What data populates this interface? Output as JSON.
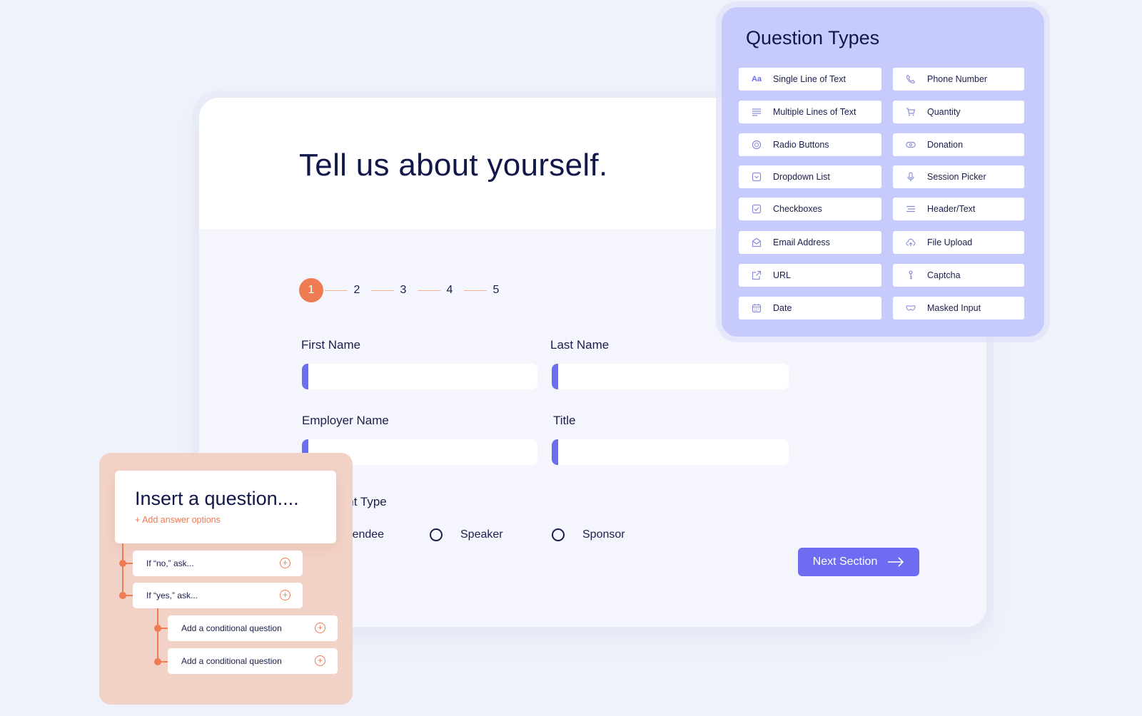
{
  "form": {
    "title": "Tell us about yourself.",
    "steps": [
      "1",
      "2",
      "3",
      "4",
      "5"
    ],
    "active_step": 1,
    "fields": {
      "first_name_label": "First Name",
      "last_name_label": "Last Name",
      "employer_name_label": "Employer Name",
      "title_label": "Title",
      "registrant_type_label": "Registrant Type"
    },
    "radio_options": [
      "Attendee",
      "Speaker",
      "Sponsor"
    ],
    "next_button_label": "Next Section"
  },
  "question_types": {
    "title": "Question Types",
    "items": [
      {
        "label": "Single Line of Text",
        "icon": "text-aa-icon"
      },
      {
        "label": "Phone Number",
        "icon": "phone-icon"
      },
      {
        "label": "Multiple Lines of Text",
        "icon": "multiline-text-icon"
      },
      {
        "label": "Quantity",
        "icon": "cart-icon"
      },
      {
        "label": "Radio Buttons",
        "icon": "radio-button-icon"
      },
      {
        "label": "Donation",
        "icon": "ticket-icon"
      },
      {
        "label": "Dropdown List",
        "icon": "dropdown-icon"
      },
      {
        "label": "Session Picker",
        "icon": "microphone-icon"
      },
      {
        "label": "Checkboxes",
        "icon": "checkbox-icon"
      },
      {
        "label": "Header/Text",
        "icon": "header-text-icon"
      },
      {
        "label": "Email Address",
        "icon": "envelope-icon"
      },
      {
        "label": "File Upload",
        "icon": "cloud-upload-icon"
      },
      {
        "label": "URL",
        "icon": "external-link-icon"
      },
      {
        "label": "Captcha",
        "icon": "captcha-icon"
      },
      {
        "label": "Date",
        "icon": "calendar-icon"
      },
      {
        "label": "Masked Input",
        "icon": "mask-icon"
      }
    ]
  },
  "insert_question": {
    "title": "Insert a question....",
    "add_options_label": "+ Add answer options",
    "conditions": [
      "If “no,” ask...",
      "If “yes,” ask...",
      "Add a conditional question",
      "Add a conditional question"
    ]
  },
  "colors": {
    "accent_orange": "#ee7b52",
    "accent_purple": "#6e6cf0",
    "panel_lavender": "#c7cbfb",
    "panel_peach": "#f2d1c6",
    "text_navy": "#12174a"
  }
}
